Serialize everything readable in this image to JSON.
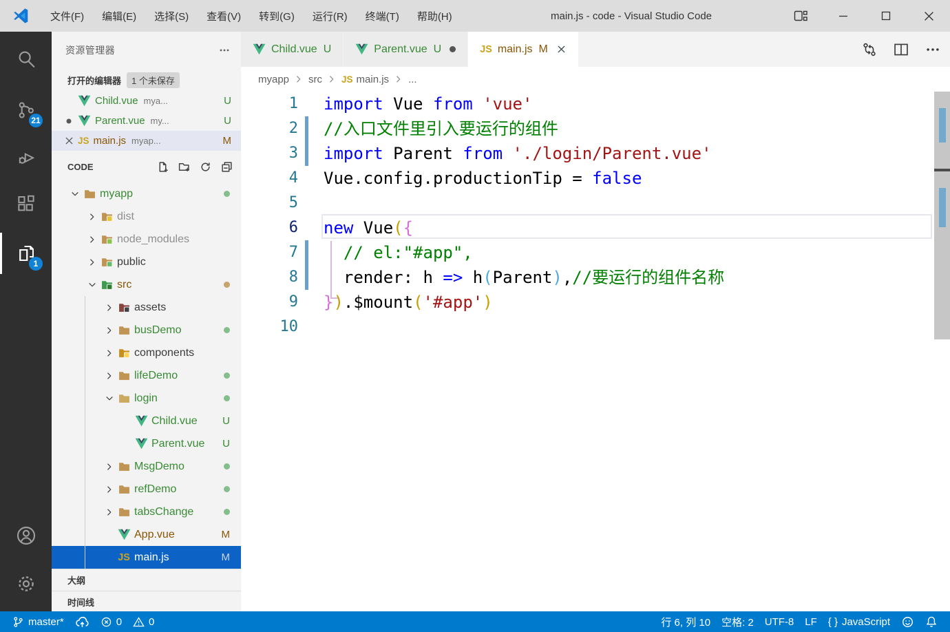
{
  "window": {
    "title": "main.js - code - Visual Studio Code",
    "menus": [
      "文件(F)",
      "编辑(E)",
      "选择(S)",
      "查看(V)",
      "转到(G)",
      "运行(R)",
      "终端(T)",
      "帮助(H)"
    ]
  },
  "activity_bar": {
    "items": [
      {
        "icon": "search-icon"
      },
      {
        "icon": "source-control-icon",
        "badge": "21"
      },
      {
        "icon": "run-debug-icon"
      },
      {
        "icon": "extensions-icon"
      },
      {
        "icon": "open-editors-pages-icon",
        "badge": "1",
        "active": true
      }
    ],
    "bottom_items": [
      {
        "icon": "account-icon"
      },
      {
        "icon": "settings-gear-icon"
      }
    ]
  },
  "sidebar": {
    "title": "资源管理器",
    "open_editors": {
      "label": "打开的编辑器",
      "badge": "1 个未保存",
      "rows": [
        {
          "pre": "none",
          "icon": "vue",
          "name": "Child.vue",
          "desc": "mya...",
          "name_class": "c-green",
          "status": "U",
          "status_class": "c-green"
        },
        {
          "pre": "dot",
          "icon": "vue",
          "name": "Parent.vue",
          "desc": "my...",
          "name_class": "c-green",
          "status": "U",
          "status_class": "c-green"
        },
        {
          "pre": "close",
          "icon": "js",
          "name": "main.js",
          "desc": "myap...",
          "name_class": "c-amber",
          "status": "M",
          "status_class": "c-amber",
          "selected": true
        }
      ]
    },
    "code_section": {
      "label": "CODE",
      "actions": [
        "new-file-icon",
        "new-folder-icon",
        "refresh-icon",
        "collapse-all-icon"
      ],
      "tree": [
        {
          "indent": 0,
          "chevron": "down",
          "icon": "folder",
          "color": "#C09553",
          "name": "myapp",
          "name_class": "c-green",
          "badge_dot": "#84BE8C"
        },
        {
          "indent": 1,
          "chevron": "right",
          "icon": "folder",
          "color": "#C09553",
          "overlay": "#E8C431",
          "name": "dist",
          "name_class": "c-gray"
        },
        {
          "indent": 1,
          "chevron": "right",
          "icon": "folder",
          "color": "#C09553",
          "overlay": "#8BC34A",
          "name": "node_modules",
          "name_class": "c-gray"
        },
        {
          "indent": 1,
          "chevron": "right",
          "icon": "folder",
          "color": "#C09553",
          "overlay": "#66BB6A",
          "name": "public",
          "name_class": "c-normal"
        },
        {
          "indent": 1,
          "chevron": "down",
          "icon": "folder",
          "color": "#3E9B4F",
          "overlay": "#2E7D32",
          "name": "src",
          "name_class": "c-amber",
          "badge_dot": "#C8A36A"
        },
        {
          "indent": 2,
          "chevron": "right",
          "icon": "folder",
          "color": "#8A4440",
          "overlay": "#424242",
          "name": "assets",
          "name_class": "c-normal"
        },
        {
          "indent": 2,
          "chevron": "right",
          "icon": "folder",
          "color": "#C09553",
          "name": "busDemo",
          "name_class": "c-green",
          "badge_dot": "#84BE8C"
        },
        {
          "indent": 2,
          "chevron": "right",
          "icon": "folder",
          "color": "#C98F1B",
          "overlay": "#FFD54F",
          "name": "components",
          "name_class": "c-normal"
        },
        {
          "indent": 2,
          "chevron": "right",
          "icon": "folder",
          "color": "#C09553",
          "name": "lifeDemo",
          "name_class": "c-green",
          "badge_dot": "#84BE8C"
        },
        {
          "indent": 2,
          "chevron": "down",
          "icon": "folder",
          "color": "#CBA95F",
          "name": "login",
          "name_class": "c-green",
          "badge_dot": "#84BE8C"
        },
        {
          "indent": 3,
          "chevron": "none",
          "icon": "vue",
          "name": "Child.vue",
          "name_class": "c-green",
          "badge_text": "U",
          "badge_class": "c-green"
        },
        {
          "indent": 3,
          "chevron": "none",
          "icon": "vue",
          "name": "Parent.vue",
          "name_class": "c-green",
          "badge_text": "U",
          "badge_class": "c-green"
        },
        {
          "indent": 2,
          "chevron": "right",
          "icon": "folder",
          "color": "#C09553",
          "name": "MsgDemo",
          "name_class": "c-green",
          "badge_dot": "#84BE8C"
        },
        {
          "indent": 2,
          "chevron": "right",
          "icon": "folder",
          "color": "#C09553",
          "name": "refDemo",
          "name_class": "c-green",
          "badge_dot": "#84BE8C"
        },
        {
          "indent": 2,
          "chevron": "right",
          "icon": "folder",
          "color": "#C09553",
          "name": "tabsChange",
          "name_class": "c-green",
          "badge_dot": "#84BE8C"
        },
        {
          "indent": 2,
          "chevron": "none",
          "icon": "vue",
          "name": "App.vue",
          "name_class": "c-amber",
          "badge_text": "M",
          "badge_class": "c-amber"
        },
        {
          "indent": 2,
          "chevron": "none",
          "icon": "js",
          "name": "main.js",
          "name_class": "c-white",
          "badge_text": "M",
          "badge_class": "c-lightgray",
          "selected": true
        }
      ]
    },
    "outline_label": "大纲",
    "timeline_label": "时间线"
  },
  "editor": {
    "tabs": [
      {
        "icon": "vue",
        "name": "Child.vue",
        "name_class": "c-green",
        "status": "U",
        "status_class": "c-green"
      },
      {
        "icon": "vue",
        "name": "Parent.vue",
        "name_class": "c-green",
        "status": "U",
        "status_class": "c-green",
        "dirty": true
      },
      {
        "icon": "js",
        "name": "main.js",
        "name_class": "c-amber",
        "status": "M",
        "status_class": "c-amber",
        "close": true,
        "active": true
      }
    ],
    "tab_actions": [
      "open-changes-icon",
      "split-editor-icon",
      "ellipsis-icon"
    ],
    "breadcrumb": [
      {
        "label": "myapp"
      },
      {
        "label": "src"
      },
      {
        "label": "main.js",
        "icon": "js"
      },
      {
        "label": "..."
      }
    ],
    "code": {
      "current_line": 6,
      "modified_ranges": [
        [
          2,
          3
        ],
        [
          7,
          8
        ]
      ],
      "lines": [
        {
          "n": "1",
          "tokens": [
            {
              "t": "import",
              "c": "kw"
            },
            {
              "t": " Vue ",
              "c": "pln"
            },
            {
              "t": "from",
              "c": "kw"
            },
            {
              "t": " ",
              "c": "pln"
            },
            {
              "t": "'vue'",
              "c": "str"
            }
          ]
        },
        {
          "n": "2",
          "tokens": [
            {
              "t": "//入口文件里引入要运行的组件",
              "c": "com"
            }
          ]
        },
        {
          "n": "3",
          "tokens": [
            {
              "t": "import",
              "c": "kw"
            },
            {
              "t": " Parent ",
              "c": "pln"
            },
            {
              "t": "from",
              "c": "kw"
            },
            {
              "t": " ",
              "c": "pln"
            },
            {
              "t": "'./login/Parent.vue'",
              "c": "str"
            }
          ]
        },
        {
          "n": "4",
          "tokens": [
            {
              "t": "Vue.config.productionTip = ",
              "c": "pln"
            },
            {
              "t": "false",
              "c": "kw"
            }
          ]
        },
        {
          "n": "5",
          "tokens": []
        },
        {
          "n": "6",
          "tokens": [
            {
              "t": "new",
              "c": "kw"
            },
            {
              "t": " Vue",
              "c": "pln"
            },
            {
              "t": "(",
              "c": "b1"
            },
            {
              "t": "{",
              "c": "b2"
            }
          ]
        },
        {
          "n": "7",
          "tokens": [
            {
              "t": "  ",
              "c": "pln"
            },
            {
              "t": "// el:\"#app\",",
              "c": "com"
            }
          ]
        },
        {
          "n": "8",
          "tokens": [
            {
              "t": "  render: h ",
              "c": "pln"
            },
            {
              "t": "=>",
              "c": "kw"
            },
            {
              "t": " h",
              "c": "pln"
            },
            {
              "t": "(",
              "c": "b3"
            },
            {
              "t": "Parent",
              "c": "pln"
            },
            {
              "t": ")",
              "c": "b3"
            },
            {
              "t": ",",
              "c": "pln"
            },
            {
              "t": "//要运行的组件名称",
              "c": "com"
            }
          ]
        },
        {
          "n": "9",
          "tokens": [
            {
              "t": "}",
              "c": "b2"
            },
            {
              "t": ")",
              "c": "b1"
            },
            {
              "t": ".$mount",
              "c": "pln"
            },
            {
              "t": "(",
              "c": "b1"
            },
            {
              "t": "'#app'",
              "c": "str"
            },
            {
              "t": ")",
              "c": "b1"
            }
          ]
        },
        {
          "n": "10",
          "tokens": []
        }
      ]
    }
  },
  "status_bar": {
    "left": [
      {
        "icon": "git-branch-icon",
        "label": "master*"
      },
      {
        "icon": "cloud-upload-icon",
        "label": ""
      },
      {
        "icon": "error-icon",
        "label": "0"
      },
      {
        "icon": "warning-icon",
        "label": "0"
      }
    ],
    "right": [
      {
        "label": "行 6, 列 10"
      },
      {
        "label": "空格: 2"
      },
      {
        "label": "UTF-8"
      },
      {
        "label": "LF"
      },
      {
        "icon": "braces-icon",
        "label": "JavaScript"
      },
      {
        "icon": "feedback-icon",
        "label": ""
      },
      {
        "icon": "bell-icon",
        "label": ""
      }
    ]
  },
  "colors": {
    "statusbar": "#007ACC",
    "activitybar": "#2F2F2F",
    "selection_blue": "#0D63C5",
    "git_added_green": "#388A34",
    "git_modified_amber": "#895503",
    "bracket_gold": "#C5A000",
    "bracket_orchid": "#D670D6",
    "bracket_skyblue": "#4FA8DD"
  }
}
